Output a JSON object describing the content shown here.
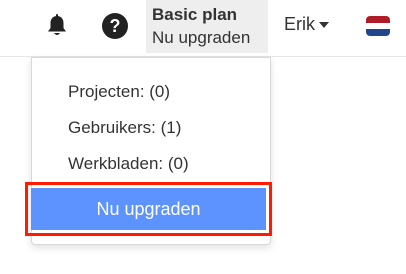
{
  "navbar": {
    "notifications_icon": "bell-icon",
    "help_icon": "question-circle-icon",
    "help_glyph": "?",
    "plan": {
      "name": "Basic plan",
      "upgrade_link": "Nu upgraden"
    },
    "user": {
      "name": "Erik",
      "caret_icon": "caret-down-icon"
    },
    "language_flag": {
      "icon": "netherlands-flag-icon",
      "colors": [
        "#ae1c28",
        "#ffffff",
        "#21468b"
      ]
    }
  },
  "plan_dropdown": {
    "items": [
      {
        "label": "Projecten: (0)"
      },
      {
        "label": "Gebruikers: (1)"
      },
      {
        "label": "Werkbladen: (0)"
      }
    ],
    "upgrade_button": "Nu upgraden"
  },
  "colors": {
    "button_bg": "#5c93ff",
    "highlight_border": "#ff1a00",
    "plan_box_bg": "#eeeeee"
  }
}
